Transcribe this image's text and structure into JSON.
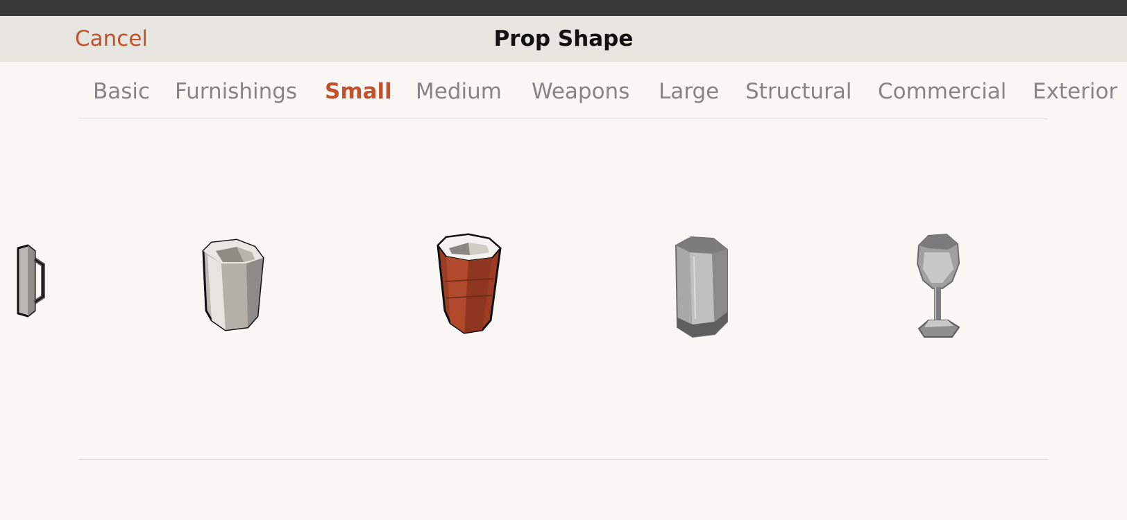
{
  "nav": {
    "cancel_label": "Cancel",
    "title": "Prop Shape"
  },
  "tabs": [
    {
      "label": "Basic",
      "active": false
    },
    {
      "label": "Furnishings",
      "active": false
    },
    {
      "label": "Small",
      "active": true
    },
    {
      "label": "Medium",
      "active": false
    },
    {
      "label": "Weapons",
      "active": false
    },
    {
      "label": "Large",
      "active": false
    },
    {
      "label": "Structural",
      "active": false
    },
    {
      "label": "Commercial",
      "active": false
    },
    {
      "label": "Exterior",
      "active": false
    }
  ],
  "shapes": [
    {
      "icon": "mug-icon"
    },
    {
      "icon": "white-cup-icon"
    },
    {
      "icon": "red-party-cup-icon"
    },
    {
      "icon": "tall-glass-icon"
    },
    {
      "icon": "wine-glass-icon"
    }
  ],
  "colors": {
    "accent": "#c0532e",
    "nav_background": "#e6e5df",
    "page_background": "#f8f7f4",
    "inactive_tab": "#858585"
  }
}
